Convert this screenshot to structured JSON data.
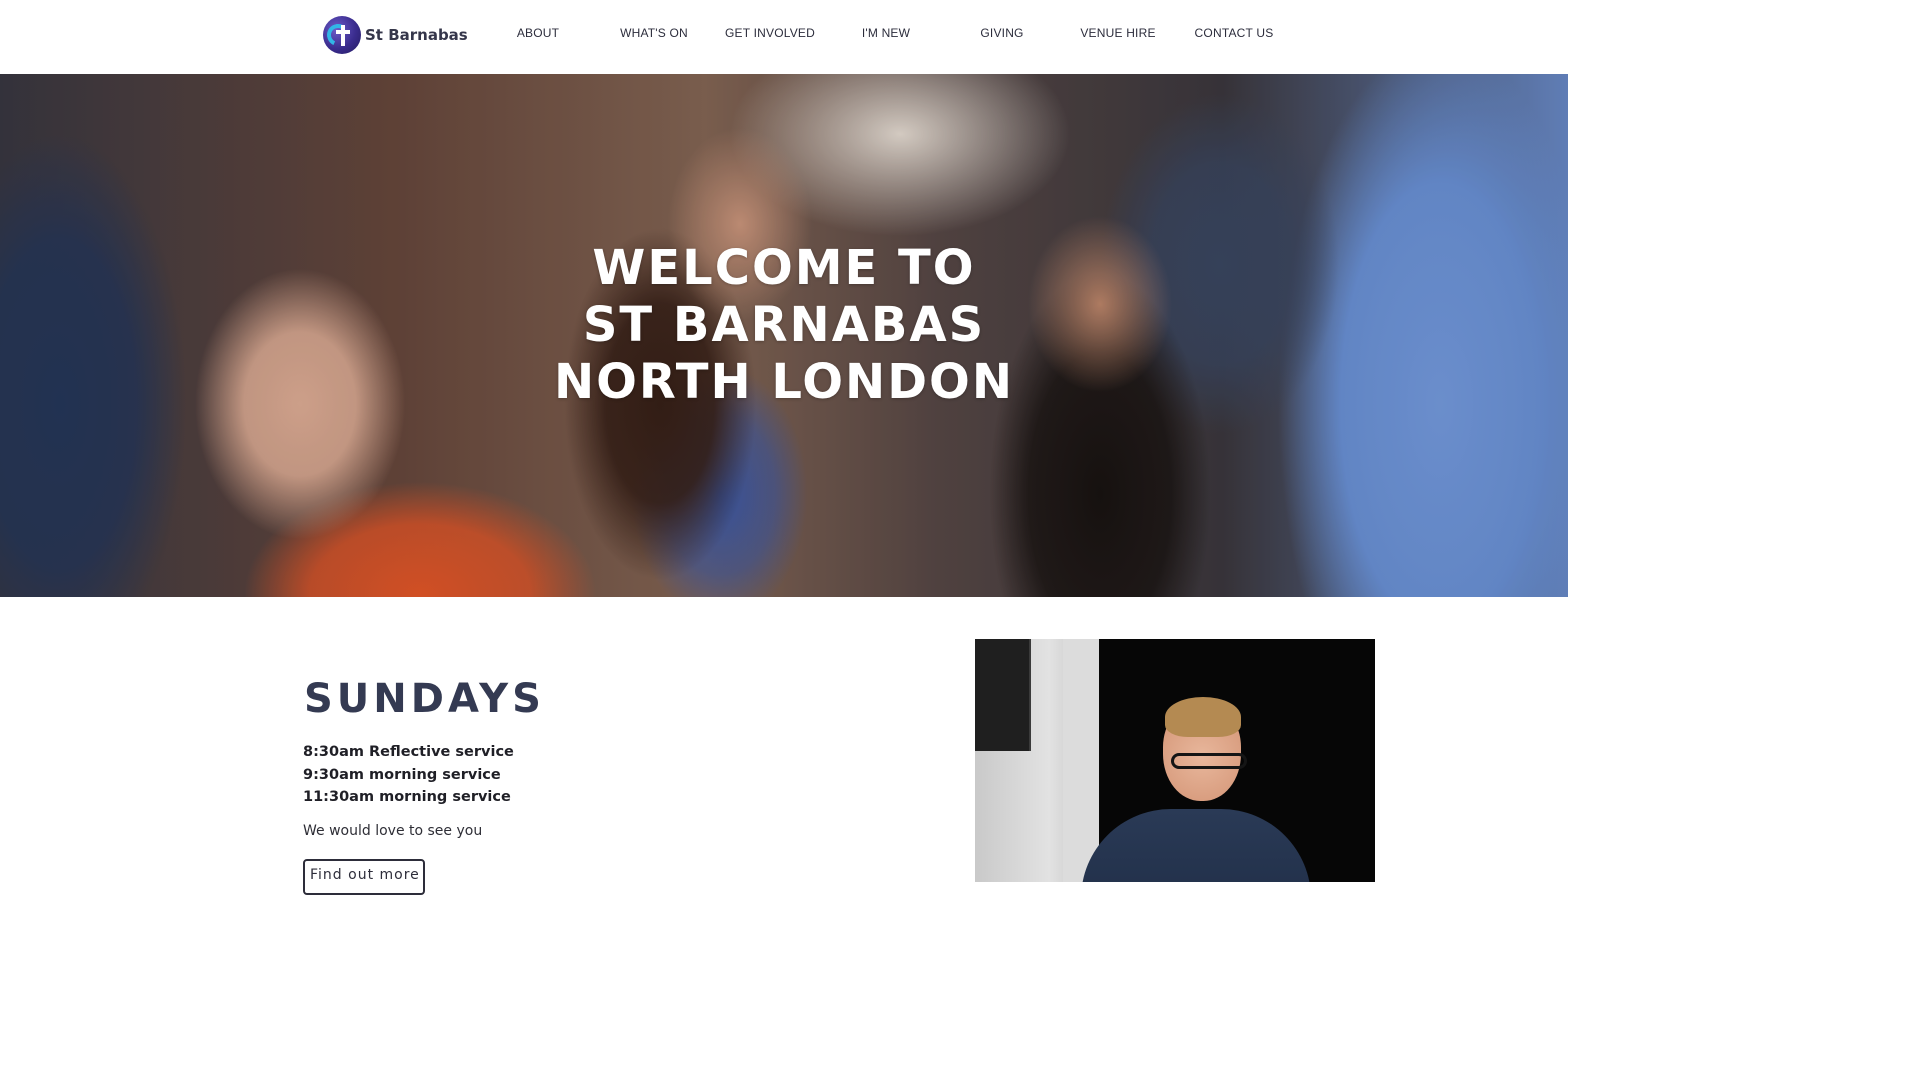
{
  "header": {
    "logo_text": "St Barnabas",
    "logo_icon": "cross-circle-logo-icon",
    "nav": [
      "ABOUT",
      "WHAT'S ON",
      "GET INVOLVED",
      "I'M NEW",
      "GIVING",
      "VENUE HIRE",
      "CONTACT US"
    ]
  },
  "hero": {
    "title_lines": [
      "WELCOME TO",
      "ST BARNABAS",
      "NORTH LONDON"
    ]
  },
  "sundays": {
    "heading": "SUNDAYS",
    "services": [
      "8:30am Reflective service",
      "9:30am morning service",
      "11:30am morning service"
    ],
    "note": "We would love to see you",
    "button_label": "Find out more"
  },
  "colors": {
    "heading_navy": "#343a52",
    "nav_text": "#2c2d3c",
    "logo_purple": "#3a2c8e",
    "logo_blue": "#32b6e6"
  }
}
